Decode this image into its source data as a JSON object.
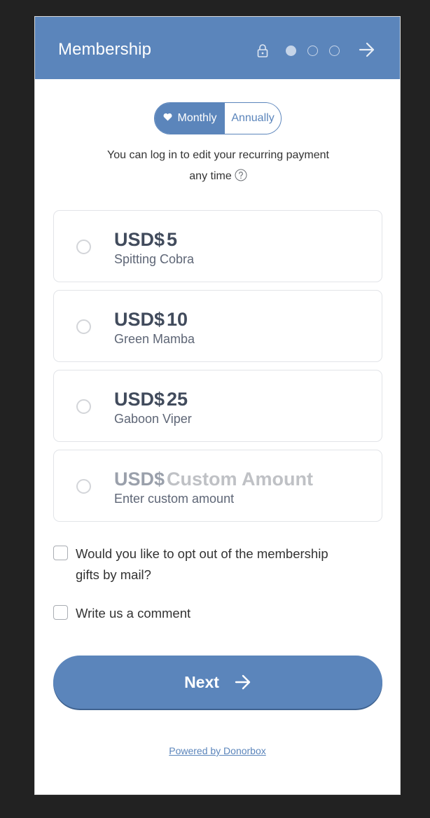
{
  "header": {
    "title": "Membership",
    "steps_total": 3,
    "current_step": 1
  },
  "frequency": {
    "options": [
      {
        "label": "Monthly",
        "selected": true,
        "icon": "heart-icon"
      },
      {
        "label": "Annually",
        "selected": false
      }
    ]
  },
  "info": {
    "line1": "You can log in to edit your recurring payment",
    "line2": "any time"
  },
  "amounts": [
    {
      "currency": "USD$",
      "value": "5",
      "name": "Spitting Cobra",
      "selected": false
    },
    {
      "currency": "USD$",
      "value": "10",
      "name": "Green Mamba",
      "selected": false
    },
    {
      "currency": "USD$",
      "value": "25",
      "name": "Gaboon Viper",
      "selected": false
    },
    {
      "currency": "USD$",
      "value": "Custom Amount",
      "name": "Enter custom amount",
      "selected": false,
      "placeholder": true
    }
  ],
  "checkboxes": [
    {
      "line1": "Would you like to opt out of the membership",
      "line2": "gifts by mail?",
      "checked": false
    },
    {
      "line1": "Write us a comment",
      "checked": false
    }
  ],
  "next_button": {
    "label": "Next"
  },
  "footer": {
    "powered_by": "Powered by Donorbox"
  },
  "colors": {
    "accent": "#5b85bb",
    "background": "#222222",
    "text": "#333333",
    "price": "#414b5c"
  }
}
